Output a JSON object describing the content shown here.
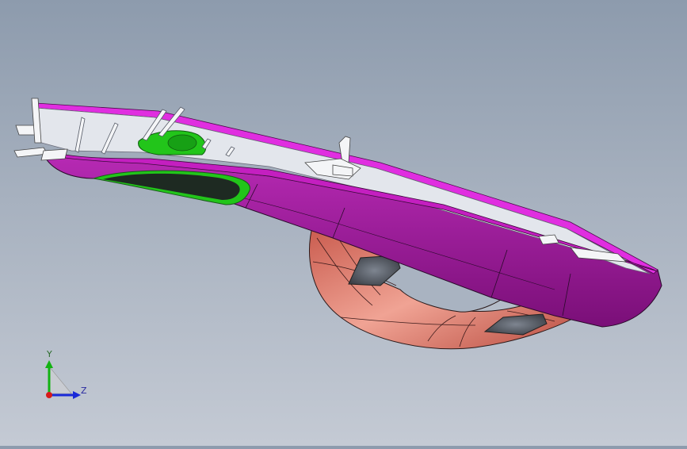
{
  "viewport": {
    "colors": {
      "body_magenta": "#a0179f",
      "body_magenta_top": "#e22fe0",
      "handle_salmon": "#e07a6a",
      "green_part": "#22c51a",
      "grey_recess": "#5a5f66"
    }
  },
  "triad": {
    "y_label": "Y",
    "z_label": "Z",
    "y_color": "#12b212",
    "z_color": "#1a2ad8",
    "origin_color": "#d81a1a"
  }
}
